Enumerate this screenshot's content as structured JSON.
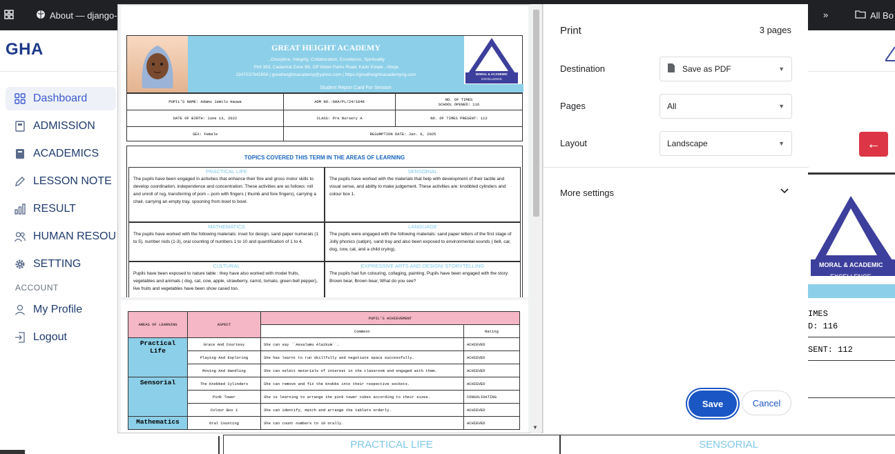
{
  "browser": {
    "tab_label": "About — django-c",
    "bookmarks_label": "All Bo"
  },
  "app": {
    "brand": "GHA"
  },
  "sidebar": {
    "items": [
      {
        "label": "Dashboard",
        "icon": "grid-icon"
      },
      {
        "label": "ADMISSION",
        "icon": "book-icon"
      },
      {
        "label": "ACADEMICS",
        "icon": "notebook-icon"
      },
      {
        "label": "LESSON NOTE",
        "icon": "pencil-icon"
      },
      {
        "label": "RESULT",
        "icon": "bar-chart-icon"
      },
      {
        "label": "HUMAN RESOUR",
        "icon": "people-icon"
      },
      {
        "label": "SETTING",
        "icon": "gear-icon"
      }
    ],
    "account_section": "ACCOUNT",
    "account_items": [
      {
        "label": "My Profile",
        "icon": "person-icon"
      },
      {
        "label": "Logout",
        "icon": "logout-icon"
      }
    ]
  },
  "print_dialog": {
    "title": "Print",
    "page_count": "3 pages",
    "destination_label": "Destination",
    "destination_value": "Save as PDF",
    "pages_label": "Pages",
    "pages_value": "All",
    "layout_label": "Layout",
    "layout_value": "Landscape",
    "more_settings": "More settings",
    "save": "Save",
    "cancel": "Cancel"
  },
  "report": {
    "school_name": "GREAT HEIGHT ACADEMY",
    "motto": "...Discipline, Integrity, Collaboration, Excellence, Spirituality",
    "address": "Plot 383, Cadastral Zone B9, Off Water Parks Road, Kado Estate , Abuja",
    "contact": "2347037942856 | greatheightsacademy@yahoo.com | https://greatheightsacademyng.com",
    "card_title": "Student Report Card For Session",
    "logo_text": "MORAL & ACADEMIC",
    "logo_sub": "EXCELLENCE",
    "pupil_name": "PUPIL'S NAME: Adamu Jamilu Hauwa",
    "adm_no": "ADM NO.:GHA/PL/24/1848",
    "times_opened": "NO. OF TIMES\nSCHOOL OPENED: 116",
    "dob": "DATE OF BIRTH: June 13, 2022",
    "class": "CLASS: Pre Nursery A",
    "times_present": "NO. OF TIMES PRESENT: 112",
    "sex": "SEX: Female",
    "resumption": "RESUMPTION DATE: Jan. 6, 2025",
    "topics_title": "TOPICS COVERED THIS TERM IN THE AREAS OF LEARNING",
    "practical_life_head": "PRACTICAL LIFE",
    "practical_life_text": "The pupils have been engaged in activities that enhance their fine and gross motor skills to develop coordination, independence and concentration. These activities are as follows: roll and unroll of rug, transferring of pom – pom with fingers ( thumb and fore fingers), carrying a chair, carrying an empty tray, spooning from bowl to bowl.",
    "sensorial_head": "SENSORIAL",
    "sensorial_text": "The pupils have worked with the materials that help with development of their tactile and visual sense, and ability to make judgement. These activities are: knobbled cylinders and colour box 1.",
    "mathematics_head": "MATHEMATICS",
    "mathematics_text": "The pupils have worked with the following materials: inset for design, sand paper numerals (1 to 5), number rods (1-3), oral counting of numbers 1 to 10 and quantification of 1 to 4.",
    "language_head": "LANGUAGE",
    "language_text": "The pupils were engaged with the following materials: sand paper letters of the first stage of Jolly phonics (satipn), sand tray and also been exposed to environmental sounds ( bell, car, dog, cow, cat, and a child crying).",
    "cultural_head": "CULTURAL",
    "cultural_text": "Pupils have been exposed to nature table : they have also worked with model fruits, vegetables and animals ( dog, cat, cow, apple, strawberry, carrot, tomato, green bell pepper), live fruits and vegetables have been show cased too.",
    "expressive_head": "EXPRESSIVE ARTS AND DESIGN/ STORYTELLING",
    "expressive_text": "The pupils had fun colouring, collaging, painting. Pupils have been engaged with the story: Brown bear, Brown bear, What do you see?"
  },
  "achievement": {
    "col_area": "AREAS OF LEARNING",
    "col_aspect": "ASPECT",
    "col_achievement": "PUPIL'S ACHIEVEMENT",
    "col_comment": "Comment",
    "col_rating": "Rating",
    "groups": [
      {
        "area": "Practical\nLife",
        "rows": [
          {
            "aspect": "Grace And Courtesy",
            "comment": "She can say ``Assalamu Alaikum``.",
            "rating": "ACHIEVED"
          },
          {
            "aspect": "Playing And Exploring",
            "comment": "She has learnt to run skillfully and negotiate space successfully.",
            "rating": "ACHIEVED"
          },
          {
            "aspect": "Moving And Handling",
            "comment": "She can select materials of interest in the classroom and engaged with them.",
            "rating": "ACHIEVED"
          }
        ]
      },
      {
        "area": "Sensorial",
        "rows": [
          {
            "aspect": "The Knobbed Cylinders",
            "comment": "She can remove and fix the knobbs into their respective sockets.",
            "rating": "ACHIEVED"
          },
          {
            "aspect": "Pink Tower",
            "comment": "She is learning to arrange the pink tower cubes according to their sizes.",
            "rating": "CONSOLIDATING"
          },
          {
            "aspect": "Colour Box 1",
            "comment": "She can identify, match and arrange the tablets orderly.",
            "rating": "ACHIEVED"
          }
        ]
      },
      {
        "area": "Mathematics",
        "rows": [
          {
            "aspect": "Oral Counting",
            "comment": "She can count numbers to 10 orally.",
            "rating": "ACHIEVED"
          }
        ]
      }
    ]
  },
  "background": {
    "times_1": "IMES",
    "times_2": "D: 116",
    "times_3": "SENT: 112",
    "bottom_left": "PRACTICAL LIFE",
    "bottom_right": "SENSORIAL"
  },
  "colors": {
    "brand": "#1d3a8a",
    "active": "#3c5bd0",
    "danger": "#dc3545",
    "report_blue": "#8ccfe8",
    "report_pink": "#f5b7c5",
    "print_blue": "#1a56c4"
  }
}
